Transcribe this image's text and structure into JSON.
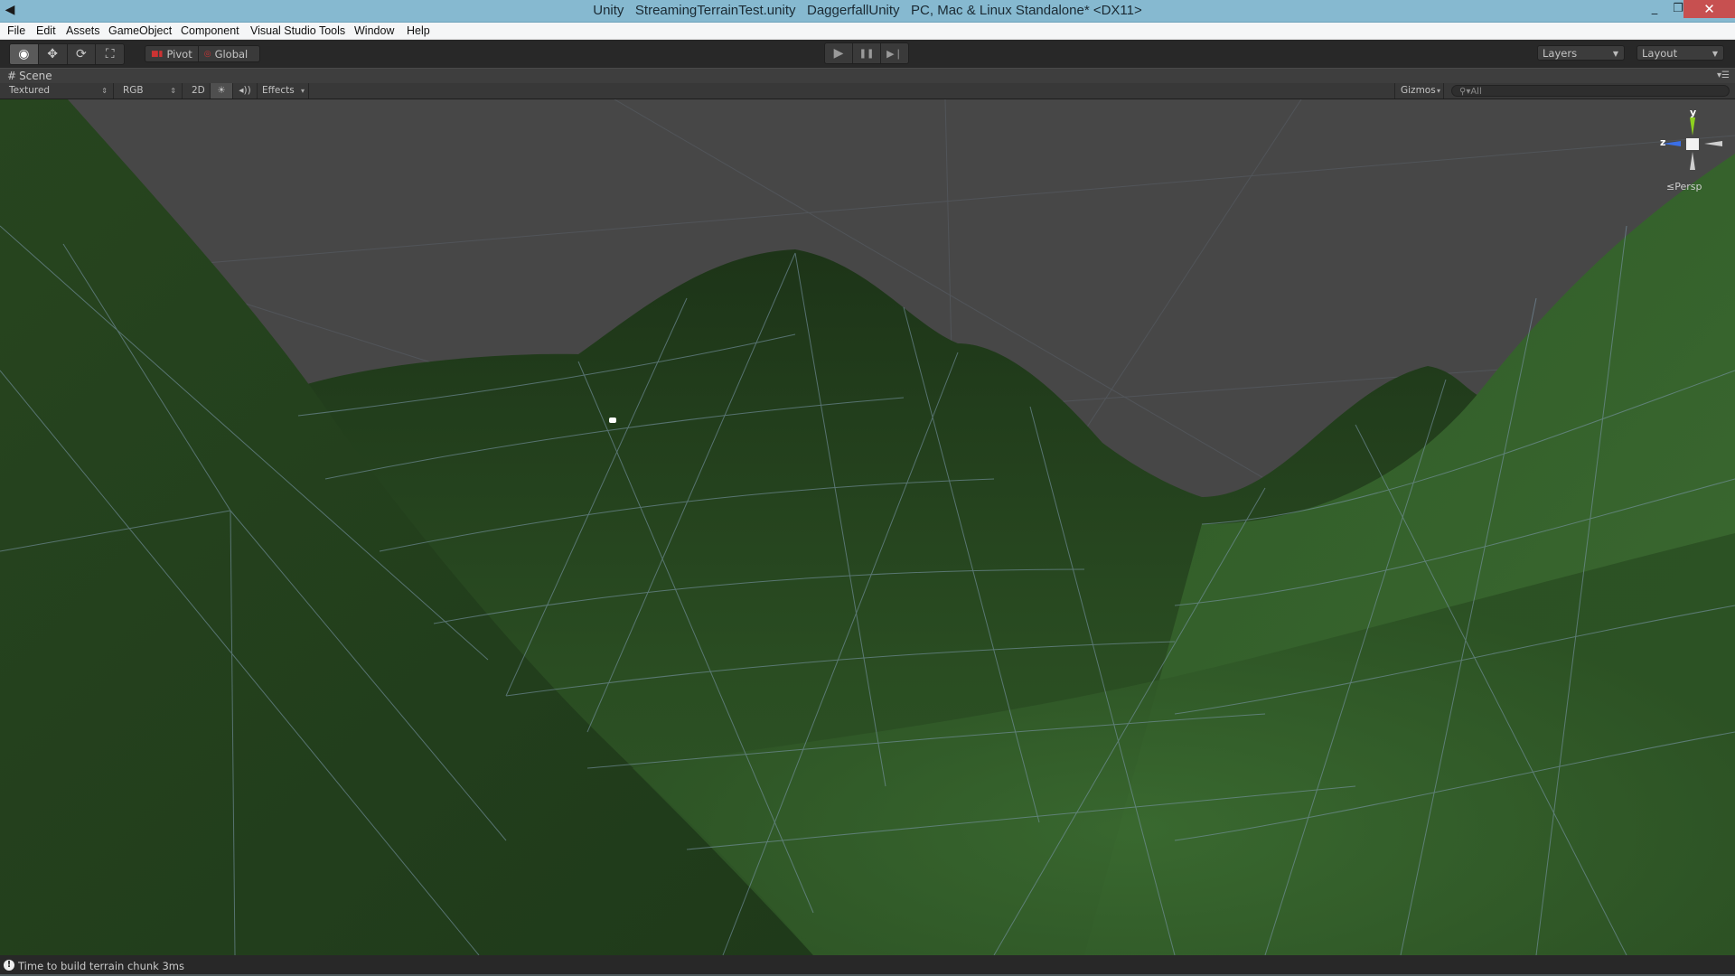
{
  "window": {
    "title": "Unity   StreamingTerrainTest.unity   DaggerfallUnity   PC, Mac & Linux Standalone* <DX11>",
    "app_icon": "unity-logo-icon",
    "controls": {
      "minimize": "_",
      "maximize": "❐",
      "close": "✕"
    }
  },
  "menubar": {
    "items": [
      {
        "label": "File"
      },
      {
        "label": "Edit"
      },
      {
        "label": "Assets"
      },
      {
        "label": "GameObject"
      },
      {
        "label": "Component"
      },
      {
        "label": "Visual Studio Tools"
      },
      {
        "label": "Window"
      },
      {
        "label": "Help"
      }
    ]
  },
  "toolbar": {
    "transform_tools": [
      {
        "name": "view-tool",
        "icon": "eye-icon",
        "glyph": "◉",
        "active": true
      },
      {
        "name": "move-tool",
        "icon": "move-arrows-icon",
        "glyph": "✥",
        "active": false
      },
      {
        "name": "rotate-tool",
        "icon": "rotate-icon",
        "glyph": "⟳",
        "active": false
      },
      {
        "name": "scale-tool",
        "icon": "scale-icon",
        "glyph": "⛶",
        "active": false
      }
    ],
    "pivot_label": "Pivot",
    "global_label": "Global",
    "play_controls": [
      {
        "name": "play",
        "icon": "play-icon",
        "glyph": "▶"
      },
      {
        "name": "pause",
        "icon": "pause-icon",
        "glyph": "❚❚"
      },
      {
        "name": "step",
        "icon": "step-icon",
        "glyph": "▶❘"
      }
    ],
    "layers_label": "Layers",
    "layout_label": "Layout"
  },
  "scene_panel": {
    "tab_label": "Scene",
    "shading_mode": "Textured",
    "render_mode": "RGB",
    "mode_2d": "2D",
    "lighting_icon": "sun-icon",
    "audio_icon": "speaker-icon",
    "effects_label": "Effects",
    "gizmos_label": "Gizmos",
    "search_placeholder": "All",
    "projection_label": "Persp",
    "gizmo_axes": {
      "y": "y",
      "z": "z"
    },
    "colors": {
      "sky": "#474747",
      "terrain_dark": "#1f3a1a",
      "terrain_mid": "#2d5225",
      "terrain_light": "#3c6a31",
      "wireframe": "#7a96a8",
      "axis_y": "#8ed11f",
      "axis_z": "#3a6fe8"
    }
  },
  "status": {
    "message": "Time to build terrain chunk 3ms",
    "icon": "info-icon"
  }
}
